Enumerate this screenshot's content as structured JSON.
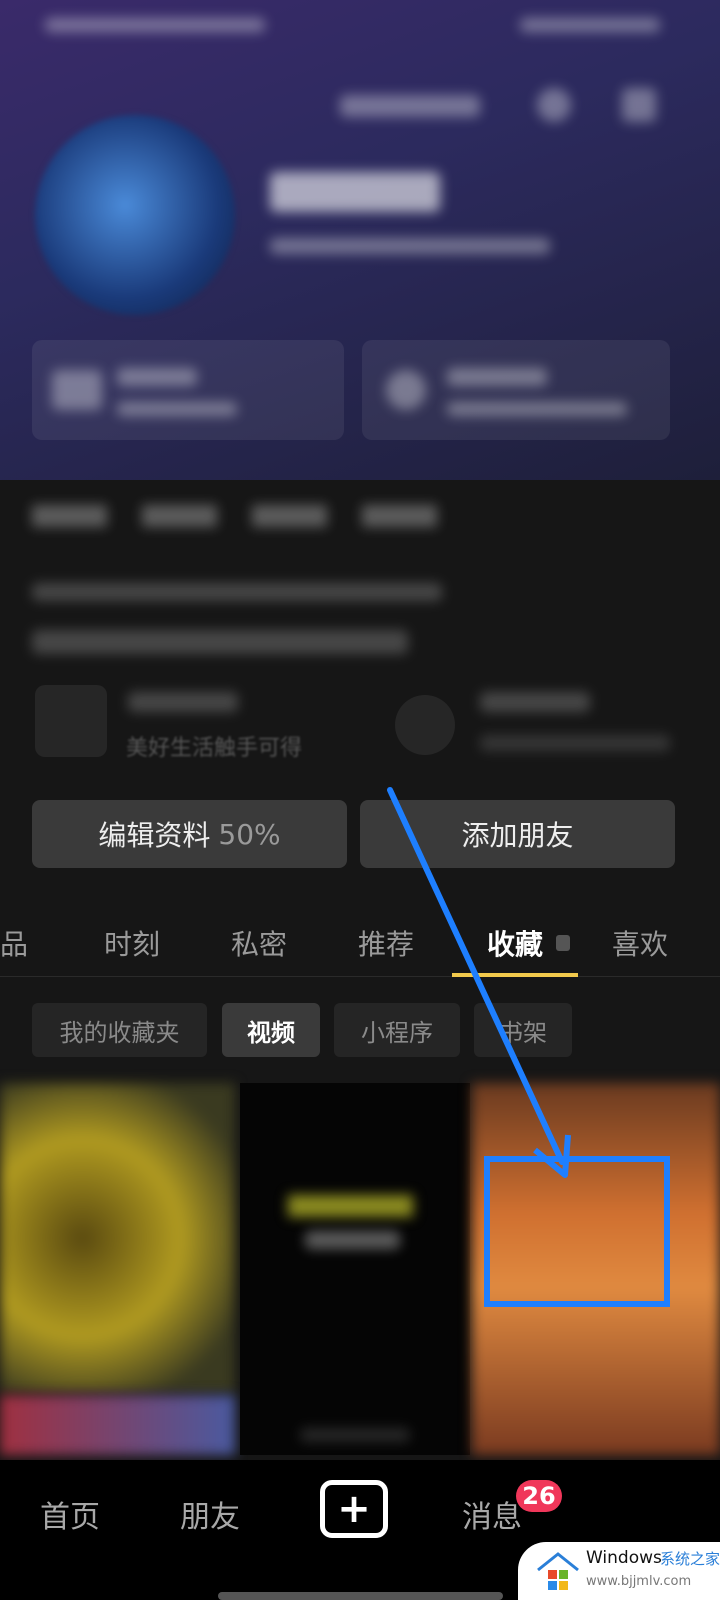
{
  "profile": {
    "bio_card_subtitle": "美好生活触手可得"
  },
  "actions": {
    "edit_label": "编辑资料",
    "edit_progress": "50%",
    "add_friend_label": "添加朋友"
  },
  "tabs": [
    {
      "label": "作品"
    },
    {
      "label": "时刻"
    },
    {
      "label": "私密"
    },
    {
      "label": "推荐"
    },
    {
      "label": "收藏",
      "locked": true,
      "active": true
    },
    {
      "label": "喜欢"
    }
  ],
  "subtabs": [
    {
      "label": "我的收藏夹"
    },
    {
      "label": "视频",
      "active": true
    },
    {
      "label": "小程序"
    },
    {
      "label": "书架"
    }
  ],
  "nav": {
    "home": "首页",
    "friends": "朋友",
    "messages": "消息",
    "messages_badge": "26",
    "create_icon": "plus-icon"
  },
  "watermark": {
    "title": "Windows",
    "title2": "系统之家",
    "url": "www.bjjmlv.com"
  },
  "colors": {
    "accent_underline": "#f2c94c",
    "badge": "#f0375a",
    "annotation": "#1e7fff"
  }
}
